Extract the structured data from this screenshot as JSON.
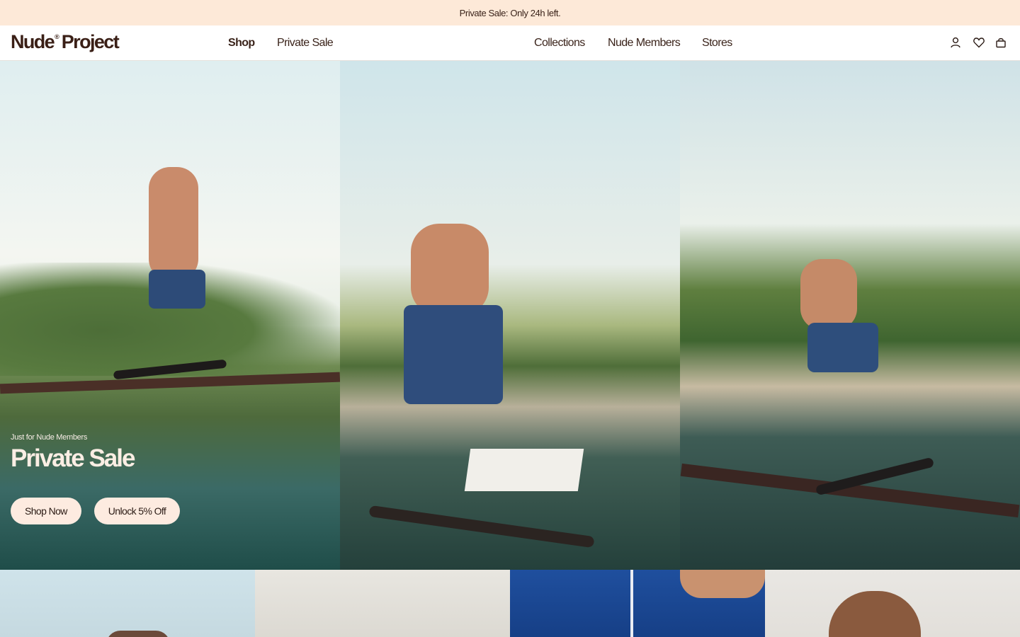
{
  "announcement": {
    "text": "Private Sale: Only 24h left."
  },
  "brand": {
    "name_part1": "Nude",
    "registered": "®",
    "name_part2": "Project"
  },
  "nav": {
    "left": [
      {
        "label": "Shop"
      },
      {
        "label": "Private Sale"
      }
    ],
    "center": [
      {
        "label": "Collections"
      },
      {
        "label": "Nude Members"
      },
      {
        "label": "Stores"
      }
    ]
  },
  "header_icons": [
    "account-icon",
    "wishlist-heart-icon",
    "cart-bag-icon"
  ],
  "hero": {
    "eyebrow": "Just for Nude Members",
    "title": "Private Sale",
    "buttons": [
      {
        "label": "Shop Now"
      },
      {
        "label": "Unlock 5% Off"
      }
    ]
  },
  "colors": {
    "announcement_bg": "#fde9d8",
    "text": "#3a231a",
    "button_bg": "#fdebe0",
    "hero_text": "#fbeee4"
  }
}
